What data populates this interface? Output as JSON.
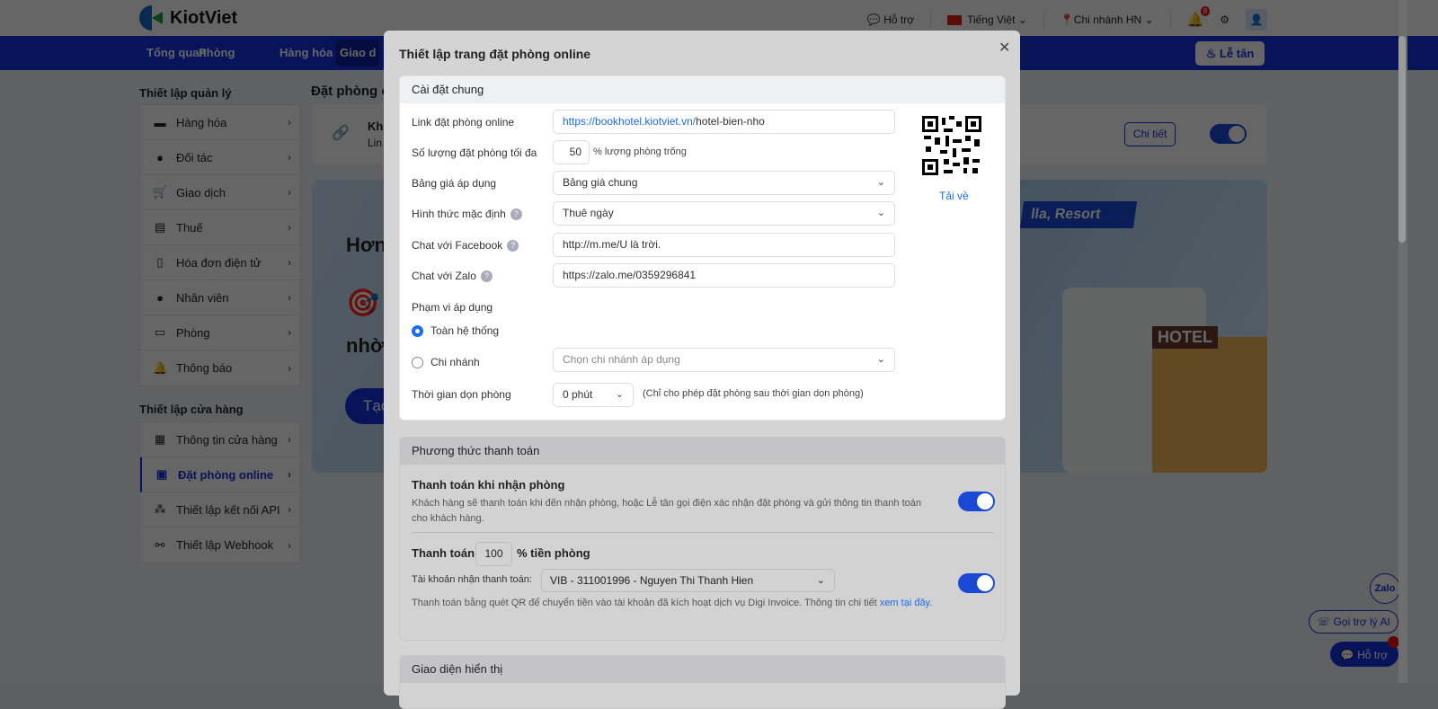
{
  "header": {
    "logo": "KiotViet",
    "support": "Hỗ trợ",
    "language": "Tiếng Việt",
    "branch": "Chi nhánh HN",
    "notif_count": "8"
  },
  "nav": {
    "items": [
      "Tổng quan",
      "Phòng",
      "Hàng hóa",
      "Giao d"
    ],
    "reception": "Lễ tân"
  },
  "sidebar": {
    "group1": "Thiết lập quản lý",
    "items1": [
      "Hàng hóa",
      "Đối tác",
      "Giao dịch",
      "Thuế",
      "Hóa đơn điện tử",
      "Nhân viên",
      "Phòng",
      "Thông báo"
    ],
    "group2": "Thiết lập cửa hàng",
    "items2": [
      "Thông tin cửa hàng",
      "Đặt phòng online",
      "Thiết lập kết nối API",
      "Thiết lập Webhook"
    ]
  },
  "content": {
    "title": "Đặt phòng o",
    "card_title": "Kh",
    "card_sub": "Lin",
    "detail_btn": "Chi tiết",
    "banner_line1": "Hơn",
    "banner_line2": "nhờ",
    "banner_btn": "Tạo",
    "banner_tag": "lla, Resort",
    "hotel_sign": "HOTEL"
  },
  "modal": {
    "title": "Thiết lập trang đặt phòng online",
    "general": {
      "header": "Cài đặt chung",
      "link_label": "Link đặt phòng online",
      "link_base": "https://bookhotel.kiotviet.vn/",
      "link_slug": "hotel-bien-nho",
      "max_label": "Số lượng đặt phòng tối đa",
      "max_value": "50",
      "max_suffix": "% lượng phòng trống",
      "price_label": "Bảng giá áp dụng",
      "price_value": "Bảng giá chung",
      "mode_label": "Hình thức mặc định",
      "mode_value": "Thuê ngày",
      "fb_label": "Chat với Facebook",
      "fb_value": "http://m.me/U là trời.",
      "zalo_label": "Chat với Zalo",
      "zalo_value": "https://zalo.me/0359296841",
      "scope_label": "Phạm vi áp dụng",
      "scope_all": "Toàn hệ thống",
      "scope_branch": "Chi nhánh",
      "branch_placeholder": "Chọn chi nhánh áp dụng",
      "clean_label": "Thời gian dọn phòng",
      "clean_value": "0 phút",
      "clean_note": "(Chỉ cho phép đặt phòng sau thời gian dọn phòng)",
      "download": "Tải về"
    },
    "payment": {
      "header": "Phương thức thanh toán",
      "on_arrival_title": "Thanh toán khi nhận phòng",
      "on_arrival_desc": "Khách hàng sẽ thanh toán khi đến nhận phòng, hoặc Lễ tân gọi điện xác nhận đặt phòng và gửi thông tin thanh toán cho khách hàng.",
      "prepay_prefix": "Thanh toán",
      "prepay_value": "100",
      "prepay_suffix": "% tiền phòng",
      "account_label": "Tài khoản nhận thanh toán:",
      "account_value": "VIB - 311001996 - Nguyen Thi Thanh Hien",
      "qr_desc": "Thanh toán bằng quét QR để chuyển tiền vào tài khoản đã kích hoạt dịch vụ Digi Invoice. Thông tin chi tiết ",
      "qr_link": "xem tại đây",
      "qr_end": "."
    },
    "display": {
      "header": "Giao diện hiển thị"
    }
  },
  "floating": {
    "zalo": "Zalo",
    "ai": "Gọi trợ lý AI",
    "support": "Hỗ trợ"
  }
}
